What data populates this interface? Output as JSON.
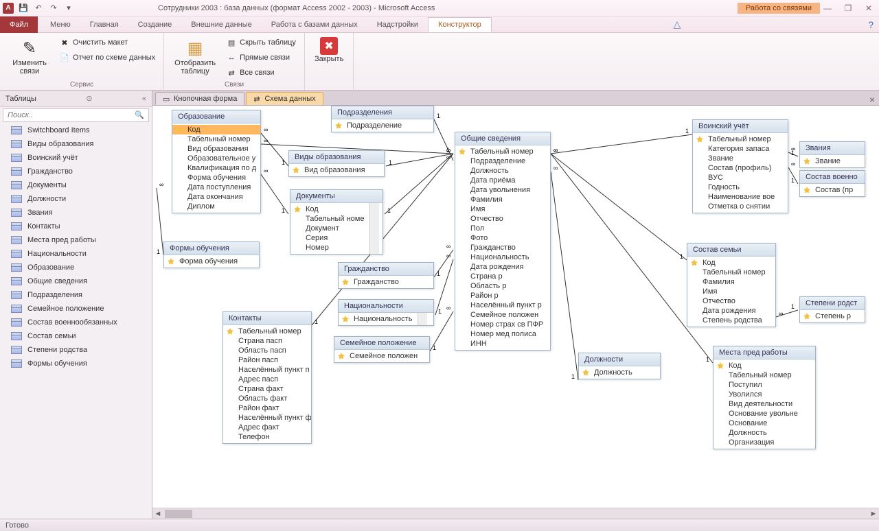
{
  "title": "Сотрудники 2003 : база данных (формат Access 2002 - 2003)  -  Microsoft Access",
  "contextual_group": "Работа со связями",
  "menu": {
    "file": "Файл",
    "items": [
      "Меню",
      "Главная",
      "Создание",
      "Внешние данные",
      "Работа с базами данных",
      "Надстройки"
    ],
    "constructor": "Конструктор"
  },
  "ribbon": {
    "g1": {
      "edit": "Изменить связи",
      "clear": "Очистить макет",
      "report": "Отчет по схеме данных",
      "label": "Сервис"
    },
    "g2": {
      "show": "Отобразить таблицу",
      "hide": "Скрыть таблицу",
      "direct": "Прямые связи",
      "all": "Все связи",
      "label": "Связи"
    },
    "g3": {
      "close": "Закрыть"
    }
  },
  "nav": {
    "header": "Таблицы",
    "search": "Поиск..",
    "items": [
      "Switchboard Items",
      "Виды образования",
      "Воинский учёт",
      "Гражданство",
      "Документы",
      "Должности",
      "Звания",
      "Контакты",
      "Места пред работы",
      "Национальности",
      "Образование",
      "Общие сведения",
      "Подразделения",
      "Семейное положение",
      "Состав военнообязанных",
      "Состав семьи",
      "Степени родства",
      "Формы обучения"
    ]
  },
  "tabs": {
    "t1": "Кнопочная форма",
    "t2": "Схема данных"
  },
  "entities": {
    "obrazovanie": {
      "title": "Образование",
      "fields": [
        "Код",
        "Табельный номер",
        "Вид образования",
        "Образовательное у",
        "Квалификация по д",
        "Форма обучения",
        "Дата поступления",
        "Дата окончания",
        "Диплом"
      ],
      "pk": [
        0
      ]
    },
    "formy": {
      "title": "Формы обучения",
      "fields": [
        "Форма обучения"
      ],
      "pk": [
        0
      ]
    },
    "vidy": {
      "title": "Виды образования",
      "fields": [
        "Вид образования"
      ],
      "pk": [
        0
      ]
    },
    "dokumenty": {
      "title": "Документы",
      "fields": [
        "Код",
        "Табельный номе",
        "Документ",
        "Серия",
        "Номер"
      ],
      "pk": [
        0
      ]
    },
    "grazhdanstvo": {
      "title": "Гражданство",
      "fields": [
        "Гражданство"
      ],
      "pk": [
        0
      ]
    },
    "natsionalnosti": {
      "title": "Национальности",
      "fields": [
        "Национальность"
      ],
      "pk": [
        0
      ]
    },
    "kontakty": {
      "title": "Контакты",
      "fields": [
        "Табельный номер",
        "Страна пасп",
        "Область пасп",
        "Район пасп",
        "Населённый пункт п",
        "Адрес пасп",
        "Страна факт",
        "Область факт",
        "Район факт",
        "Населённый пункт ф",
        "Адрес факт",
        "Телефон"
      ],
      "pk": [
        0
      ]
    },
    "semeinoe": {
      "title": "Семейное положение",
      "fields": [
        "Семейное положен"
      ],
      "pk": [
        0
      ]
    },
    "podrazdeleniya": {
      "title": "Подразделения",
      "fields": [
        "Подразделение"
      ],
      "pk": [
        0
      ]
    },
    "obshie": {
      "title": "Общие сведения",
      "fields": [
        "Табельный номер",
        "Подразделение",
        "Должность",
        "Дата приёма",
        "Дата увольнения",
        "Фамилия",
        "Имя",
        "Отчество",
        "Пол",
        "Фото",
        "Гражданство",
        "Национальность",
        "Дата рождения",
        "Страна р",
        "Область р",
        "Район р",
        "Населённый пункт р",
        "Семейное положен",
        "Номер страх св ПФР",
        "Номер мед полиса",
        "ИНН"
      ],
      "pk": [
        0
      ]
    },
    "dolzhnosti": {
      "title": "Должности",
      "fields": [
        "Должность"
      ],
      "pk": [
        0
      ]
    },
    "voinskiy": {
      "title": "Воинский учёт",
      "fields": [
        "Табельный номер",
        "Категория запаса",
        "Звание",
        "Состав (профиль)",
        "ВУС",
        "Годность",
        "Наименование вое",
        "Отметка о снятии"
      ],
      "pk": [
        0
      ]
    },
    "zvaniya": {
      "title": "Звания",
      "fields": [
        "Звание"
      ],
      "pk": [
        0
      ]
    },
    "sostavvoen": {
      "title": "Состав военно",
      "fields": [
        "Состав (пр"
      ],
      "pk": [
        0
      ]
    },
    "sostavsemyi": {
      "title": "Состав семьи",
      "fields": [
        "Код",
        "Табельный номер",
        "Фамилия",
        "Имя",
        "Отчество",
        "Дата рождения",
        "Степень родства"
      ],
      "pk": [
        0
      ]
    },
    "stepeni": {
      "title": "Степени родст",
      "fields": [
        "Степень р"
      ],
      "pk": [
        0
      ]
    },
    "mesta": {
      "title": "Места пред работы",
      "fields": [
        "Код",
        "Табельный номер",
        "Поступил",
        "Уволился",
        "Вид деятельности",
        "Основание увольне",
        "Основание",
        "Должность",
        "Организация"
      ],
      "pk": [
        0
      ]
    }
  },
  "status": "Готово"
}
